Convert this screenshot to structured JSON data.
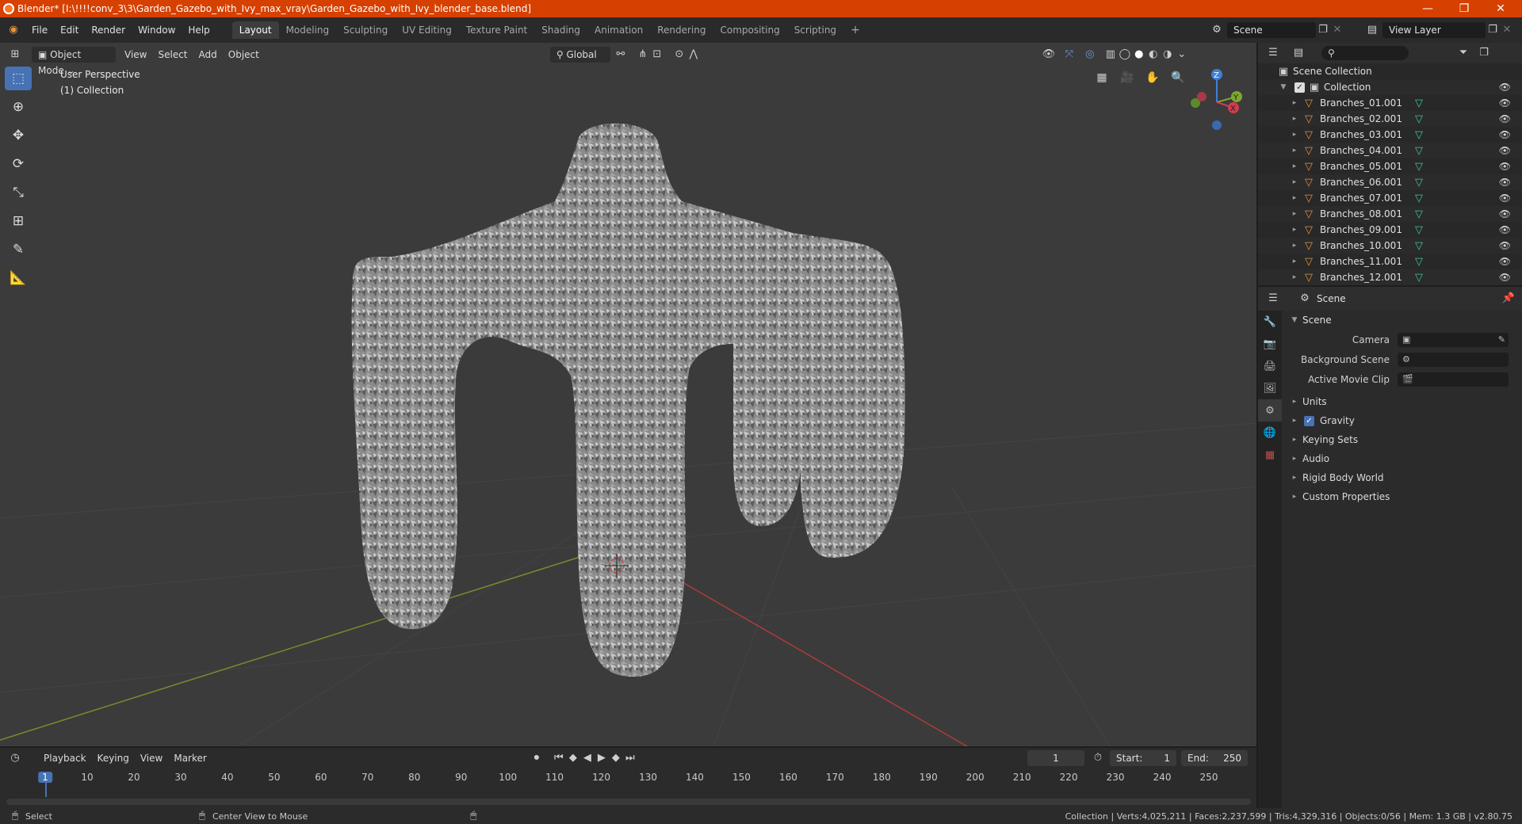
{
  "window": {
    "title": "Blender* [I:\\!!!!conv_3\\3\\Garden_Gazebo_with_Ivy_max_vray\\Garden_Gazebo_with_Ivy_blender_base.blend]",
    "minimize": "—",
    "maximize": "❐",
    "close": "✕"
  },
  "menu": [
    "File",
    "Edit",
    "Render",
    "Window",
    "Help"
  ],
  "workspaces": [
    "Layout",
    "Modeling",
    "Sculpting",
    "UV Editing",
    "Texture Paint",
    "Shading",
    "Animation",
    "Rendering",
    "Compositing",
    "Scripting"
  ],
  "active_workspace": "Layout",
  "add_workspace": "+",
  "scene_field": "Scene",
  "view_layer_field": "View Layer",
  "viewport": {
    "mode": "Object Mode",
    "menus": [
      "View",
      "Select",
      "Add",
      "Object"
    ],
    "transform_orientation": "Global",
    "info_line1": "User Perspective",
    "info_line2": "(1) Collection",
    "axis_z": "Z",
    "axis_y": "Y",
    "axis_x": "X"
  },
  "outliner": {
    "root": "Scene Collection",
    "collection": "Collection",
    "items": [
      "Branches_01.001",
      "Branches_02.001",
      "Branches_03.001",
      "Branches_04.001",
      "Branches_05.001",
      "Branches_06.001",
      "Branches_07.001",
      "Branches_08.001",
      "Branches_09.001",
      "Branches_10.001",
      "Branches_11.001",
      "Branches_12.001"
    ]
  },
  "properties": {
    "header": "Scene",
    "section": "Scene",
    "camera_label": "Camera",
    "background_scene_label": "Background Scene",
    "active_movie_clip_label": "Active Movie Clip",
    "subsections": [
      "Units",
      "Gravity",
      "Keying Sets",
      "Audio",
      "Rigid Body World",
      "Custom Properties"
    ]
  },
  "timeline": {
    "menus": [
      "Playback",
      "Keying",
      "View",
      "Marker"
    ],
    "current_frame": "1",
    "start_label": "Start:",
    "start_value": "1",
    "end_label": "End:",
    "end_value": "250",
    "frame_ticks": [
      "1",
      "10",
      "20",
      "30",
      "40",
      "50",
      "60",
      "70",
      "80",
      "90",
      "100",
      "110",
      "120",
      "130",
      "140",
      "150",
      "160",
      "170",
      "180",
      "190",
      "200",
      "210",
      "220",
      "230",
      "240",
      "250"
    ]
  },
  "status": {
    "left_action": "Select",
    "middle_action": "Center View to Mouse",
    "stats": "Collection | Verts:4,025,211 | Faces:2,237,599 | Tris:4,329,316 | Objects:0/56 | Mem: 1.3 GB | v2.80.75"
  }
}
